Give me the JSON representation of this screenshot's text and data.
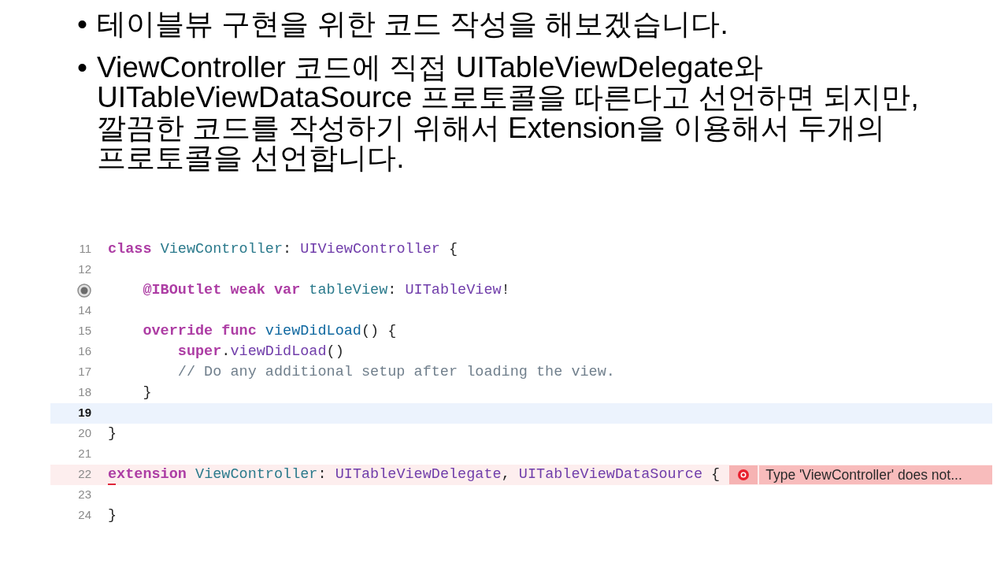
{
  "bullets": [
    {
      "marker": "•",
      "lines": [
        "테이블뷰 구현을 위한 코드 작성을 해보겠습니다."
      ]
    },
    {
      "marker": "•",
      "lines": [
        "ViewController 코드에 직접 UITableViewDelegate와",
        "UITableViewDataSource 프로토콜을 따른다고 선언하면 되지만,",
        "깔끔한 코드를 작성하기 위해서 Extension을 이용해서 두개의",
        "프로토콜을 선언합니다."
      ]
    }
  ],
  "code": {
    "lines": [
      {
        "kind": "number",
        "number": "11",
        "current": false,
        "error": false,
        "tokens": [
          {
            "text": "class ",
            "kind": "keyword"
          },
          {
            "text": "ViewController",
            "kind": "decl"
          },
          {
            "text": ": ",
            "kind": "plain"
          },
          {
            "text": "UIViewController",
            "kind": "type"
          },
          {
            "text": " {",
            "kind": "plain"
          }
        ]
      },
      {
        "kind": "number",
        "number": "12",
        "current": false,
        "error": false
      },
      {
        "kind": "outlet",
        "current": false,
        "error": false,
        "tokens": [
          {
            "text": "    @IBOutlet weak var ",
            "kind": "keyword"
          },
          {
            "text": "tableView",
            "kind": "decl"
          },
          {
            "text": ": ",
            "kind": "plain"
          },
          {
            "text": "UITableView",
            "kind": "type"
          },
          {
            "text": "!",
            "kind": "plain"
          }
        ]
      },
      {
        "kind": "number",
        "number": "14",
        "current": false,
        "error": false
      },
      {
        "kind": "number",
        "number": "15",
        "current": false,
        "error": false,
        "tokens": [
          {
            "text": "    override func ",
            "kind": "keyword"
          },
          {
            "text": "viewDidLoad",
            "kind": "func"
          },
          {
            "text": "() {",
            "kind": "plain"
          }
        ]
      },
      {
        "kind": "number",
        "number": "16",
        "current": false,
        "error": false,
        "tokens": [
          {
            "text": "        super",
            "kind": "keyword"
          },
          {
            "text": ".",
            "kind": "plain"
          },
          {
            "text": "viewDidLoad",
            "kind": "type"
          },
          {
            "text": "()",
            "kind": "plain"
          }
        ]
      },
      {
        "kind": "number",
        "number": "17",
        "current": false,
        "error": false,
        "tokens": [
          {
            "text": "        // Do any additional setup after loading the view.",
            "kind": "comment"
          }
        ]
      },
      {
        "kind": "number",
        "number": "18",
        "current": false,
        "error": false,
        "tokens": [
          {
            "text": "    }",
            "kind": "plain"
          }
        ]
      },
      {
        "kind": "number",
        "number": "19",
        "current": true,
        "error": false
      },
      {
        "kind": "number",
        "number": "20",
        "current": false,
        "error": false,
        "tokens": [
          {
            "text": "}",
            "kind": "plain"
          }
        ]
      },
      {
        "kind": "number",
        "number": "21",
        "current": false,
        "error": false
      },
      {
        "kind": "number",
        "number": "22",
        "current": false,
        "error": true,
        "message": "Type 'ViewController' does not...",
        "tokens": [
          {
            "text": "extension ",
            "kind": "keyword"
          },
          {
            "text": "ViewController",
            "kind": "decl"
          },
          {
            "text": ": ",
            "kind": "plain"
          },
          {
            "text": "UITableViewDelegate",
            "kind": "type"
          },
          {
            "text": ", ",
            "kind": "plain"
          },
          {
            "text": "UITableViewDataSource",
            "kind": "type"
          },
          {
            "text": " {",
            "kind": "plain"
          }
        ]
      },
      {
        "kind": "number",
        "number": "23",
        "current": false,
        "error": false
      },
      {
        "kind": "number",
        "number": "24",
        "current": false,
        "error": false,
        "tokens": [
          {
            "text": "}",
            "kind": "plain"
          }
        ]
      }
    ]
  }
}
